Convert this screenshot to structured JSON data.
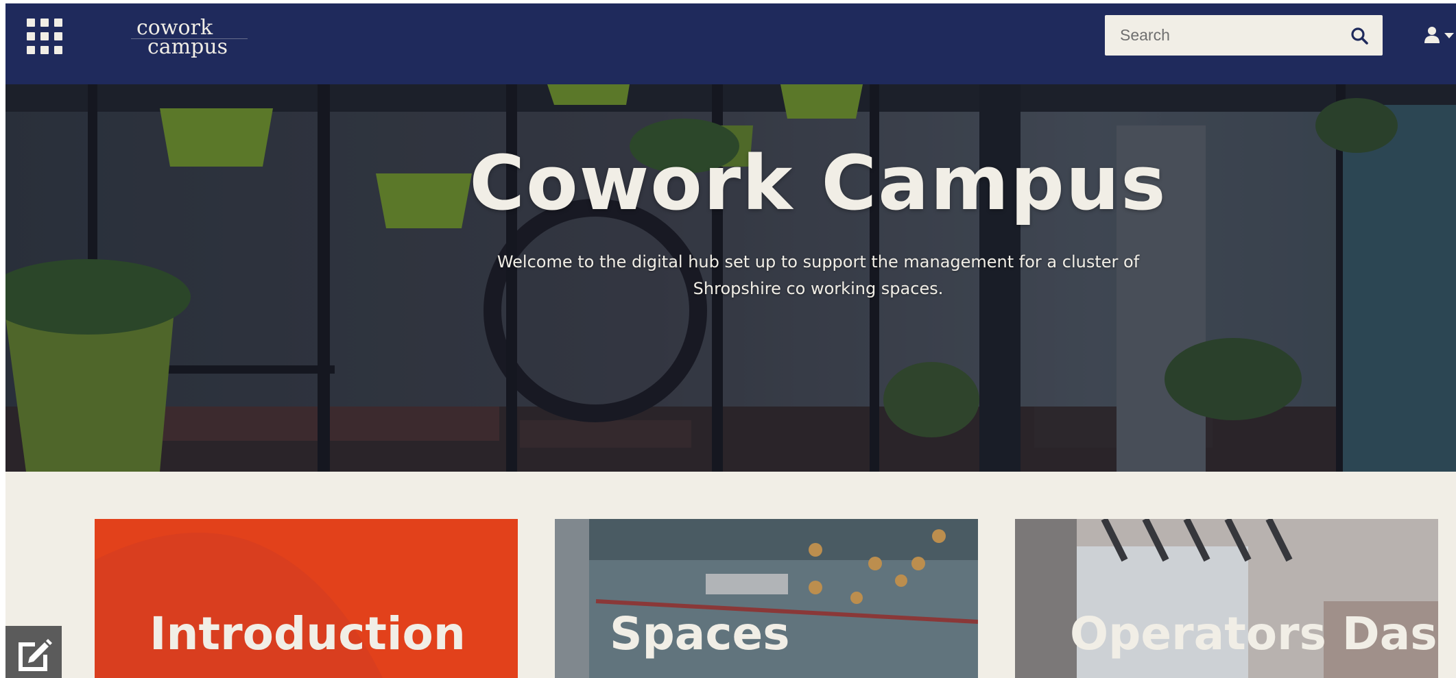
{
  "header": {
    "logo_line1": "cowork",
    "logo_line2": "campus",
    "search": {
      "placeholder": "Search",
      "value": ""
    },
    "icons": [
      "apps-grid-icon",
      "search-icon",
      "user-icon",
      "caret-down-icon"
    ]
  },
  "hero": {
    "title": "Cowork Campus",
    "subtitle": "Welcome to the digital hub set up to support the management for a cluster of Shropshire co working spaces."
  },
  "cards": [
    {
      "label": "Introduction"
    },
    {
      "label": "Spaces"
    },
    {
      "label": "Operators Dashboard"
    }
  ],
  "colors": {
    "header_bg": "#1f2a5c",
    "page_bg": "#f1eee6",
    "intro_card": "#e2411b",
    "text_light": "#f1eee6"
  },
  "edit_icon": "edit-icon"
}
